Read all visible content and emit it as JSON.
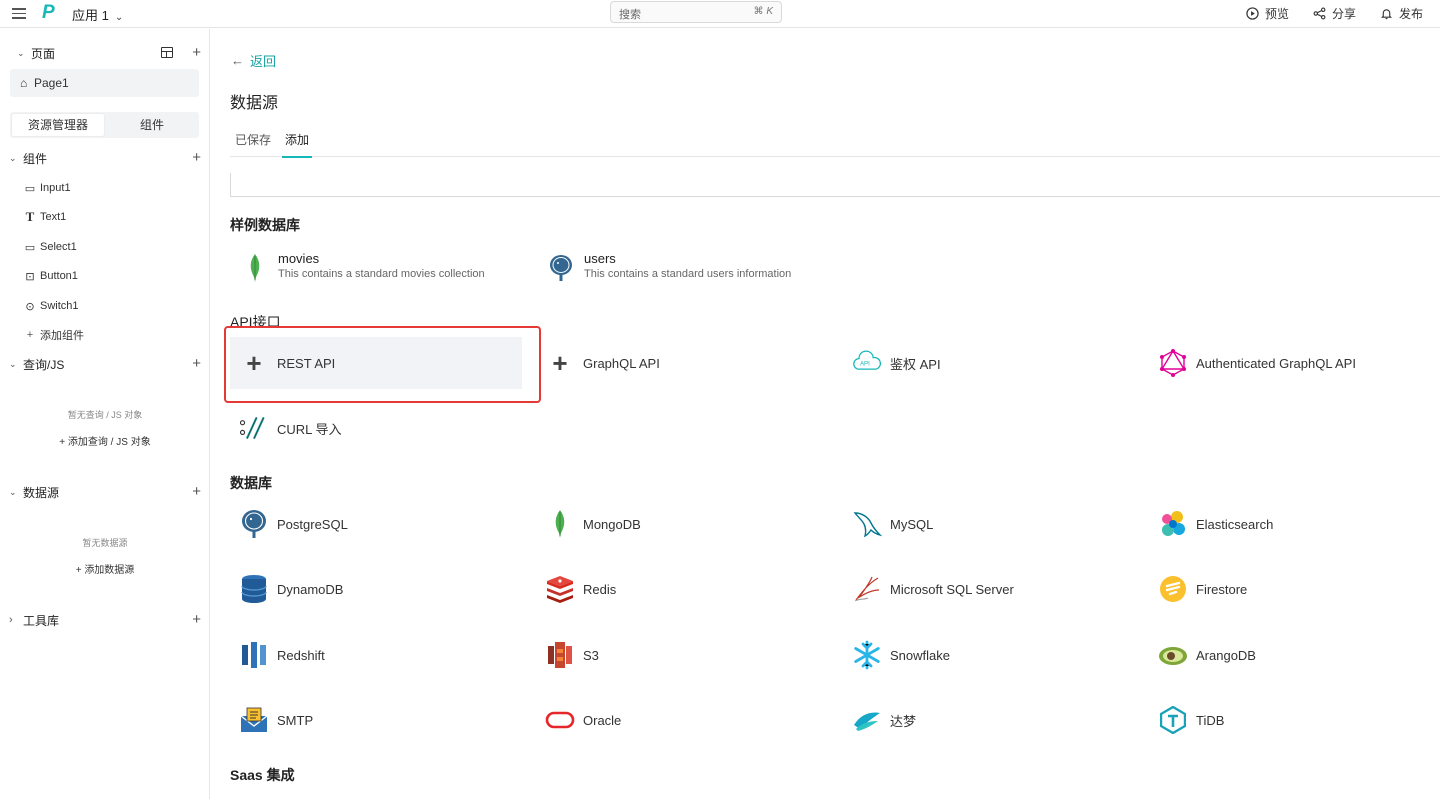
{
  "topbar": {
    "app_name": "应用 1",
    "search_placeholder": "搜索",
    "search_shortcut": "⌘ K",
    "preview": "预览",
    "share": "分享",
    "publish": "发布"
  },
  "sidebar": {
    "pages_title": "页面",
    "page_item": "Page1",
    "seg_explorer": "资源管理器",
    "seg_widgets": "组件",
    "widgets_title": "组件",
    "widgets": [
      "Input1",
      "Text1",
      "Select1",
      "Button1",
      "Switch1"
    ],
    "add_widget": "添加组件",
    "queries_title": "查询/JS",
    "queries_empty": "暂无查询 / JS 对象",
    "add_query": "添加查询 / JS 对象",
    "datasources_title": "数据源",
    "datasources_empty": "暂无数据源",
    "add_datasource": "添加数据源",
    "libraries_title": "工具库"
  },
  "main": {
    "back": "返回",
    "title": "数据源",
    "tab_saved": "已保存",
    "tab_add": "添加",
    "sample_title": "样例数据库",
    "samples": [
      {
        "name": "movies",
        "desc": "This contains a standard movies collection"
      },
      {
        "name": "users",
        "desc": "This contains a standard users information"
      }
    ],
    "api_title": "API接口",
    "apis": [
      "REST API",
      "GraphQL API",
      "鉴权 API",
      "Authenticated GraphQL API",
      "CURL 导入"
    ],
    "db_title": "数据库",
    "databases": [
      "PostgreSQL",
      "MongoDB",
      "MySQL",
      "Elasticsearch",
      "DynamoDB",
      "Redis",
      "Microsoft SQL Server",
      "Firestore",
      "Redshift",
      "S3",
      "Snowflake",
      "ArangoDB",
      "SMTP",
      "Oracle",
      "达梦",
      "TiDB"
    ],
    "saas_title": "Saas 集成"
  },
  "colors": {
    "accent": "#14b8b8",
    "highlight": "#e53935"
  }
}
